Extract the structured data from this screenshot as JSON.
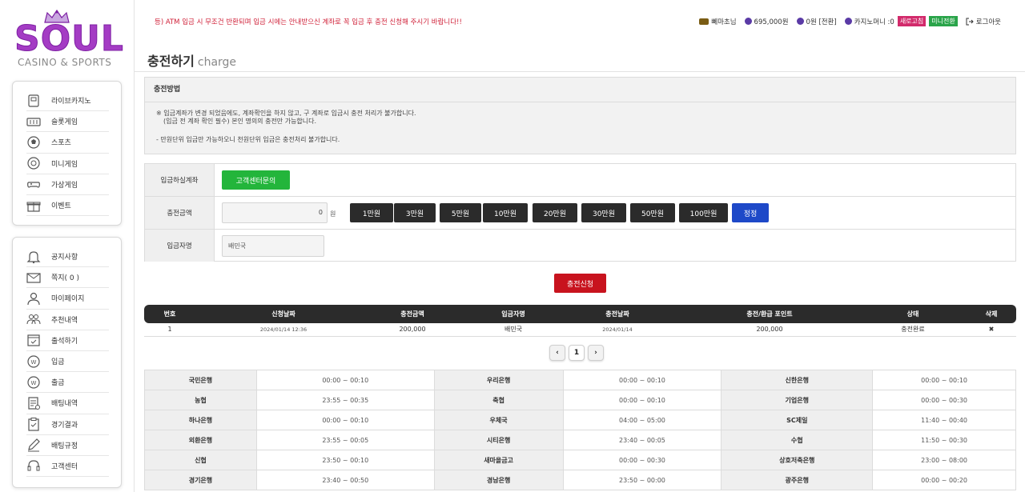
{
  "brand": {
    "logo_text": "SOUL",
    "logo_sub": "CASINO & SPORTS"
  },
  "notice": "등) ATM 입금 시 무조건 반환되며 입금 시에는 안내받으신 계좌로 꼭 입금 후 충전 신청해 주시기 바랍니다!!",
  "user": {
    "name": "뻬마초님",
    "money": "695,000원",
    "point": "0원 [전환]",
    "casino_money": "카지노머니 :0",
    "refresh_label": "새로고침",
    "mini_label": "미니전환",
    "logout_label": "로그아웃"
  },
  "page_title": {
    "main": "충전하기",
    "sub": "charge"
  },
  "sidebar": {
    "top": [
      {
        "label": "라이브카지노",
        "icon": "live-casino-icon"
      },
      {
        "label": "슬롯게임",
        "icon": "slot-icon"
      },
      {
        "label": "스포츠",
        "icon": "soccer-ball-icon"
      },
      {
        "label": "미니게임",
        "icon": "mini-game-icon"
      },
      {
        "label": "가상게임",
        "icon": "gamepad-icon"
      },
      {
        "label": "이벤트",
        "icon": "gift-icon"
      }
    ],
    "bottom": [
      {
        "label": "공지사항",
        "icon": "bell-icon"
      },
      {
        "label": "쪽지( 0 )",
        "icon": "envelope-icon"
      },
      {
        "label": "마이페이지",
        "icon": "user-icon"
      },
      {
        "label": "추천내역",
        "icon": "users-icon"
      },
      {
        "label": "출석하기",
        "icon": "calendar-check-icon"
      },
      {
        "label": "입금",
        "icon": "deposit-coin-icon"
      },
      {
        "label": "출금",
        "icon": "withdraw-coin-icon"
      },
      {
        "label": "배팅내역",
        "icon": "bet-history-icon"
      },
      {
        "label": "경기결과",
        "icon": "clipboard-icon"
      },
      {
        "label": "배팅규정",
        "icon": "pencil-icon"
      },
      {
        "label": "고객센터",
        "icon": "headset-icon"
      }
    ]
  },
  "method": {
    "heading": "충전방법",
    "line1": "※ 입금계좌가 변경 되었음에도, 계좌확인을 하지 않고, 구 계좌로 입금시 충전 처리가 불가합니다.",
    "line2": "(입금 전 계좌 확인 필수) 본인 명의의 충전만 가능합니다.",
    "line3": "- 만원단위 입금만 가능하오니 천원단위 입금은 충전처리 불가합니다."
  },
  "form": {
    "account_label": "입금하실계좌",
    "account_button": "고객센터문의",
    "amount_label": "충전금액",
    "amount_value": "0",
    "won_unit": "원",
    "amount_buttons": [
      "1만원",
      "3만원",
      "5만원",
      "10만원",
      "20만원",
      "30만원",
      "50만원",
      "100만원"
    ],
    "reset_label": "정정",
    "depositor_label": "입금자명",
    "depositor_value": "배민국",
    "apply_label": "충전신청"
  },
  "history": {
    "headers": [
      "번호",
      "신청날짜",
      "충전금액",
      "입금자명",
      "충전날짜",
      "충전/환급 포인트",
      "상태",
      "삭제"
    ],
    "rows": [
      [
        "1",
        "2024/01/14 12:36",
        "200,000",
        "배민국",
        "2024/01/14",
        "200,000",
        "충전완료",
        "✖"
      ]
    ]
  },
  "pagination": {
    "prev": "‹",
    "current": "1",
    "next": "›"
  },
  "banks": [
    [
      [
        "국민은행",
        "00:00 ~ 00:10"
      ],
      [
        "우리은행",
        "00:00 ~ 00:10"
      ],
      [
        "신한은행",
        "00:00 ~ 00:10"
      ]
    ],
    [
      [
        "농협",
        "23:55 ~ 00:35"
      ],
      [
        "축협",
        "00:00 ~ 00:10"
      ],
      [
        "기업은행",
        "00:00 ~ 00:30"
      ]
    ],
    [
      [
        "하나은행",
        "00:00 ~ 00:10"
      ],
      [
        "우체국",
        "04:00 ~ 05:00"
      ],
      [
        "SC제일",
        "11:40 ~ 00:40"
      ]
    ],
    [
      [
        "외환은행",
        "23:55 ~ 00:05"
      ],
      [
        "시티은행",
        "23:40 ~ 00:05"
      ],
      [
        "수협",
        "11:50 ~ 00:30"
      ]
    ],
    [
      [
        "신협",
        "23:50 ~ 00:10"
      ],
      [
        "새마을금고",
        "00:00 ~ 00:30"
      ],
      [
        "상호저축은행",
        "23:00 ~ 08:00"
      ]
    ],
    [
      [
        "경기은행",
        "23:40 ~ 00:50"
      ],
      [
        "경남은행",
        "23:50 ~ 00:00"
      ],
      [
        "광주은행",
        "00:00 ~ 00:20"
      ]
    ]
  ]
}
